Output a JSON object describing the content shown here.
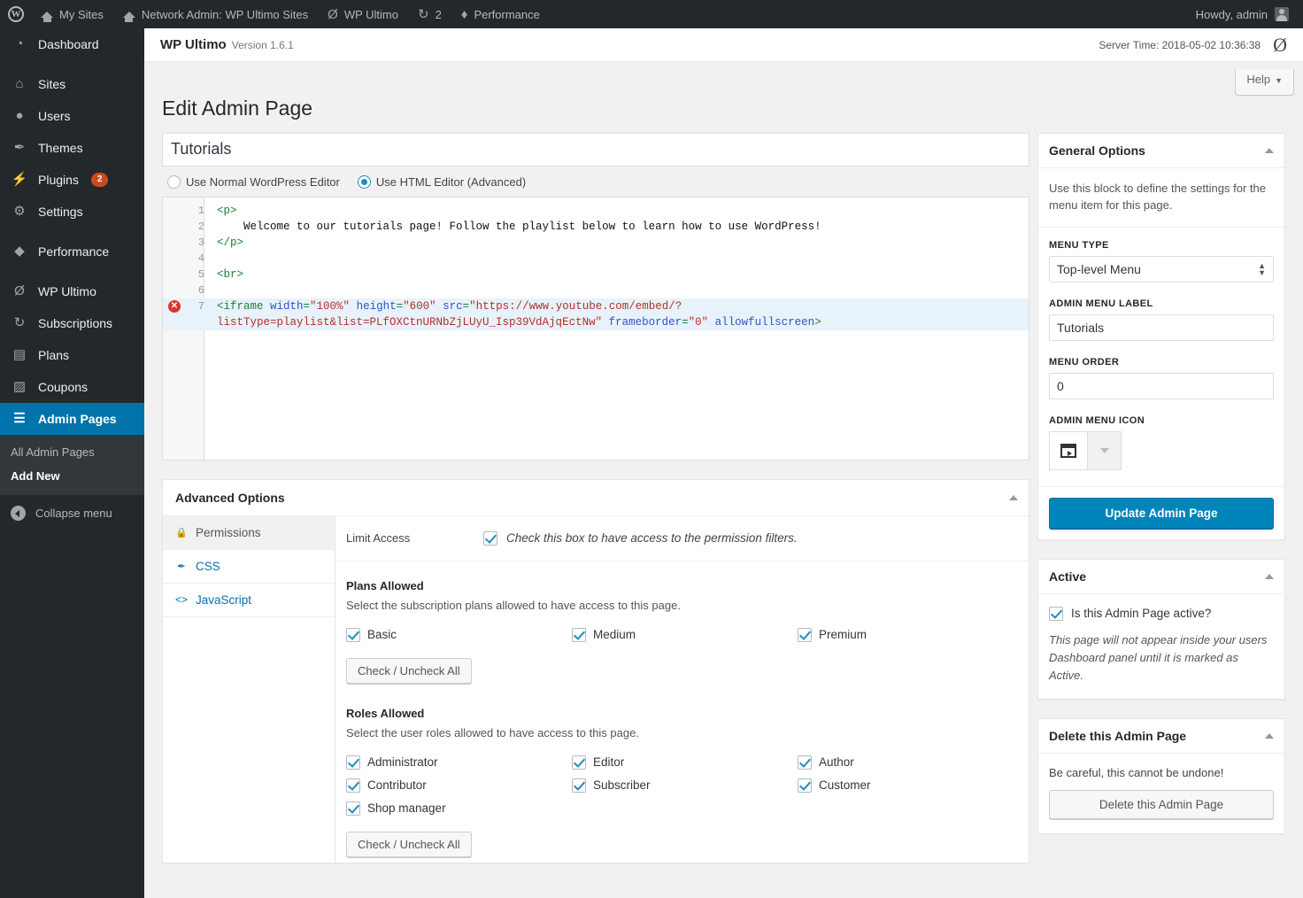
{
  "adminbar": {
    "logo_icon": "wordpress-logo-icon",
    "items": [
      {
        "label": "My Sites",
        "icon": "sites-icon"
      },
      {
        "label": "Network Admin: WP Ultimo Sites",
        "icon": "home-icon"
      },
      {
        "label": "WP Ultimo",
        "icon": "wp-ultimo-icon"
      },
      {
        "label": "2",
        "icon": "updates-icon"
      },
      {
        "label": "Performance",
        "icon": "performance-icon"
      }
    ],
    "howdy": "Howdy, admin"
  },
  "sidebar": {
    "items": [
      {
        "label": "Dashboard",
        "icon": "dashboard-icon",
        "badge": null,
        "current": false,
        "sep": false
      },
      {
        "label": "Sites",
        "icon": "sites-icon",
        "badge": null,
        "current": false,
        "sep": true
      },
      {
        "label": "Users",
        "icon": "users-icon",
        "badge": null,
        "current": false,
        "sep": false
      },
      {
        "label": "Themes",
        "icon": "themes-icon",
        "badge": null,
        "current": false,
        "sep": false
      },
      {
        "label": "Plugins",
        "icon": "plugins-icon",
        "badge": "2",
        "current": false,
        "sep": false
      },
      {
        "label": "Settings",
        "icon": "settings-icon",
        "badge": null,
        "current": false,
        "sep": false
      },
      {
        "label": "Performance",
        "icon": "performance-icon",
        "badge": null,
        "current": false,
        "sep": true
      },
      {
        "label": "WP Ultimo",
        "icon": "wp-ultimo-icon",
        "badge": null,
        "current": false,
        "sep": true
      },
      {
        "label": "Subscriptions",
        "icon": "subscriptions-icon",
        "badge": null,
        "current": false,
        "sep": false
      },
      {
        "label": "Plans",
        "icon": "plans-icon",
        "badge": null,
        "current": false,
        "sep": false
      },
      {
        "label": "Coupons",
        "icon": "coupons-icon",
        "badge": null,
        "current": false,
        "sep": false
      },
      {
        "label": "Admin Pages",
        "icon": "admin-pages-icon",
        "badge": null,
        "current": true,
        "sep": false
      }
    ],
    "submenu": [
      {
        "label": "All Admin Pages",
        "active": false
      },
      {
        "label": "Add New",
        "active": true
      }
    ],
    "collapse_label": "Collapse menu",
    "active_accent": "#0073aa"
  },
  "plugin_header": {
    "brand": "WP Ultimo",
    "version": "Version 1.6.1",
    "server_time": "Server Time: 2018-05-02 10:36:38",
    "mark_icon": "wp-ultimo-icon"
  },
  "help": {
    "label": "Help",
    "caret": "▼"
  },
  "page": {
    "title": "Edit Admin Page"
  },
  "post": {
    "title_value": "Tutorials",
    "title_placeholder": "Enter title here"
  },
  "editor_mode": {
    "normal_label": "Use Normal WordPress Editor",
    "html_label": "Use HTML Editor (Advanced)",
    "selected": "html"
  },
  "code_editor": {
    "error_icon": "error-marker-icon",
    "lines": [
      {
        "n": "1",
        "error": false,
        "highlight": false,
        "segments": [
          {
            "t": "tag",
            "v": "<p>"
          }
        ]
      },
      {
        "n": "2",
        "error": false,
        "highlight": false,
        "segments": [
          {
            "t": "txt",
            "v": "    Welcome to our tutorials page! Follow the playlist below to learn how to use WordPress!"
          }
        ]
      },
      {
        "n": "3",
        "error": false,
        "highlight": false,
        "segments": [
          {
            "t": "tag",
            "v": "</p>"
          }
        ]
      },
      {
        "n": "4",
        "error": false,
        "highlight": false,
        "segments": []
      },
      {
        "n": "5",
        "error": false,
        "highlight": false,
        "segments": [
          {
            "t": "tag",
            "v": "<br>"
          }
        ]
      },
      {
        "n": "6",
        "error": false,
        "highlight": false,
        "segments": []
      },
      {
        "n": "7",
        "error": true,
        "highlight": true,
        "segments": [
          {
            "t": "tag",
            "v": "<iframe "
          },
          {
            "t": "attr",
            "v": "width"
          },
          {
            "t": "tag",
            "v": "="
          },
          {
            "t": "str",
            "v": "\"100%\""
          },
          {
            "t": "tag",
            "v": " "
          },
          {
            "t": "attr",
            "v": "height"
          },
          {
            "t": "tag",
            "v": "="
          },
          {
            "t": "str",
            "v": "\"600\""
          },
          {
            "t": "tag",
            "v": " "
          },
          {
            "t": "attr",
            "v": "src"
          },
          {
            "t": "tag",
            "v": "="
          },
          {
            "t": "str",
            "v": "\"https://www.youtube.com/embed/?"
          }
        ]
      },
      {
        "n": "",
        "error": false,
        "highlight": true,
        "segments": [
          {
            "t": "str",
            "v": "listType=playlist&list=PLfOXCtnURNbZjLUyU_Isp39VdAjqEctNw\""
          },
          {
            "t": "tag",
            "v": " "
          },
          {
            "t": "attr",
            "v": "frameborder"
          },
          {
            "t": "tag",
            "v": "="
          },
          {
            "t": "str",
            "v": "\"0\""
          },
          {
            "t": "tag",
            "v": " "
          },
          {
            "t": "attr",
            "v": "allowfullscreen"
          },
          {
            "t": "tag",
            "v": ">"
          }
        ]
      }
    ]
  },
  "advanced_options": {
    "title": "Advanced Options",
    "collapse_icon": "triangle-up-icon",
    "tabs": [
      {
        "label": "Permissions",
        "icon": "lock-icon",
        "active": true
      },
      {
        "label": "CSS",
        "icon": "brush-icon",
        "active": false
      },
      {
        "label": "JavaScript",
        "icon": "code-brackets-icon",
        "active": false
      }
    ],
    "limit_access": {
      "label": "Limit Access",
      "checked": true,
      "description": "Check this box to have access to the permission filters."
    },
    "plans_allowed": {
      "heading": "Plans Allowed",
      "hint": "Select the subscription plans allowed to have access to this page.",
      "options": [
        {
          "label": "Basic",
          "checked": true
        },
        {
          "label": "Medium",
          "checked": true
        },
        {
          "label": "Premium",
          "checked": true
        }
      ],
      "toggle_all_label": "Check / Uncheck All"
    },
    "roles_allowed": {
      "heading": "Roles Allowed",
      "hint": "Select the user roles allowed to have access to this page.",
      "options": [
        {
          "label": "Administrator",
          "checked": true
        },
        {
          "label": "Editor",
          "checked": true
        },
        {
          "label": "Author",
          "checked": true
        },
        {
          "label": "Contributor",
          "checked": true
        },
        {
          "label": "Subscriber",
          "checked": true
        },
        {
          "label": "Customer",
          "checked": true
        },
        {
          "label": "Shop manager",
          "checked": true
        }
      ],
      "toggle_all_label": "Check / Uncheck All"
    }
  },
  "general_options": {
    "title": "General Options",
    "collapse_icon": "triangle-up-icon",
    "description": "Use this block to define the settings for the menu item for this page.",
    "menu_type": {
      "label": "MENU TYPE",
      "value": "Top-level Menu"
    },
    "admin_menu_label": {
      "label": "ADMIN MENU LABEL",
      "value": "Tutorials"
    },
    "menu_order": {
      "label": "MENU ORDER",
      "value": "0"
    },
    "admin_menu_icon": {
      "label": "ADMIN MENU ICON",
      "icon": "video-playlist-icon"
    },
    "update_button": "Update Admin Page",
    "primary_color": "#0085ba"
  },
  "active_box": {
    "title": "Active",
    "collapse_icon": "triangle-up-icon",
    "checkbox_label": "Is this Admin Page active?",
    "checked": true,
    "note": "This page will not appear inside your users Dashboard panel until it is marked as Active."
  },
  "delete_box": {
    "title": "Delete this Admin Page",
    "collapse_icon": "triangle-up-icon",
    "warning": "Be careful, this cannot be undone!",
    "button": "Delete this Admin Page"
  }
}
